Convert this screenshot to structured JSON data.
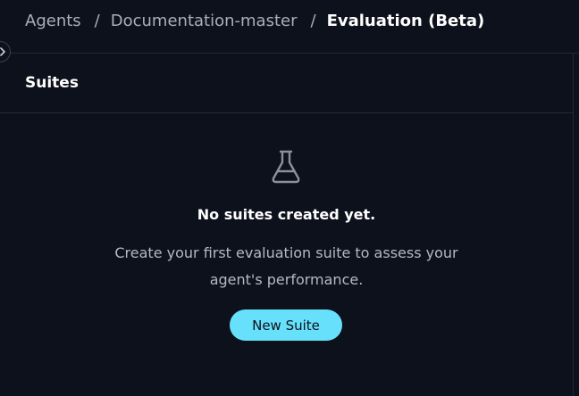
{
  "breadcrumb": {
    "items": [
      {
        "label": "Agents"
      },
      {
        "label": "Documentation-master"
      },
      {
        "label": "Evaluation (Beta)"
      }
    ],
    "separator": "/"
  },
  "section": {
    "title": "Suites"
  },
  "empty_state": {
    "icon": "flask-icon",
    "title": "No suites created yet.",
    "description": "Create your first evaluation suite to assess your agent's performance.",
    "button_label": "New Suite"
  },
  "colors": {
    "background": "#0d111b",
    "accent": "#67e1fb",
    "divider": "#232835"
  }
}
